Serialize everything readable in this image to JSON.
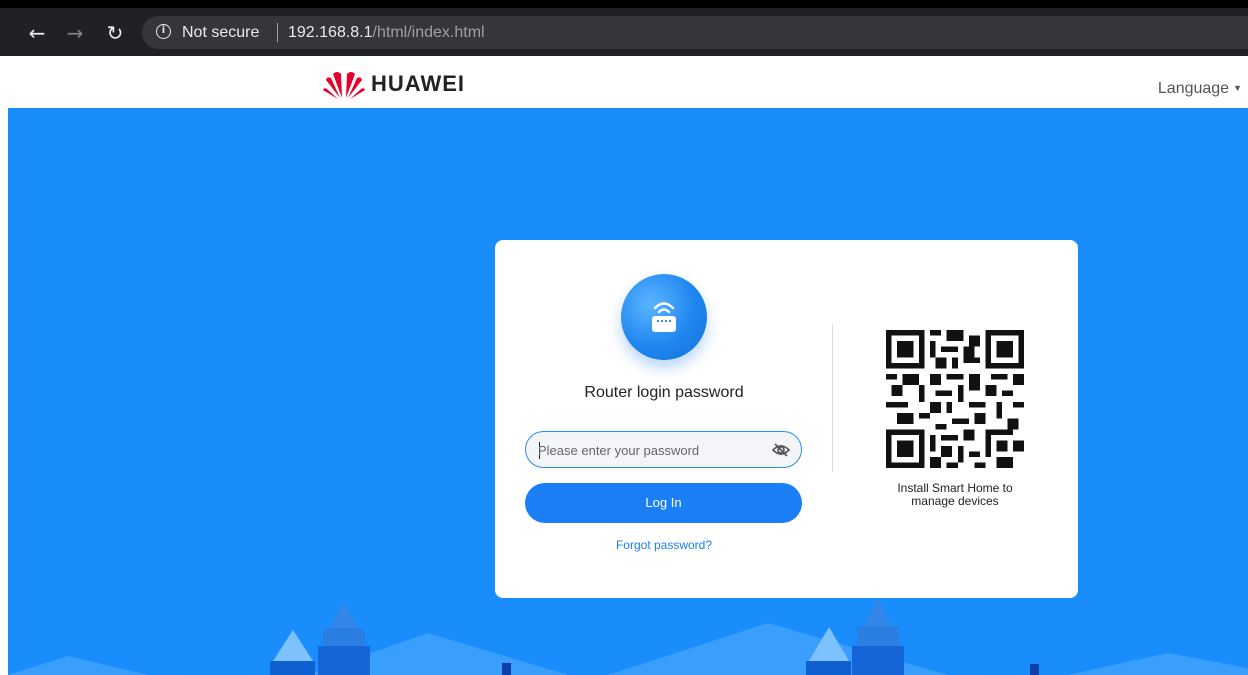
{
  "browser": {
    "back_icon": "arrow-left-icon",
    "forward_icon": "arrow-right-icon",
    "reload_icon": "reload-icon",
    "security_icon": "info-icon",
    "security_text": "Not secure",
    "url_host": "192.168.8.1",
    "url_path": "/html/index.html"
  },
  "header": {
    "brand": "HUAWEI",
    "language_label": "Language"
  },
  "login": {
    "icon": "router-wifi-icon",
    "title": "Router login password",
    "password_value": "",
    "password_placeholder": "Please enter your password",
    "toggle_icon": "eye-slash-icon",
    "login_button": "Log In",
    "forgot_link": "Forgot password?"
  },
  "app_promo": {
    "qr_icon": "qr-code-icon",
    "caption_line1": "Install Smart Home to",
    "caption_line2": "manage devices"
  },
  "colors": {
    "hero_blue": "#1a8dfc",
    "button_blue": "#1a7ff5",
    "brand_red": "#e4032b"
  }
}
